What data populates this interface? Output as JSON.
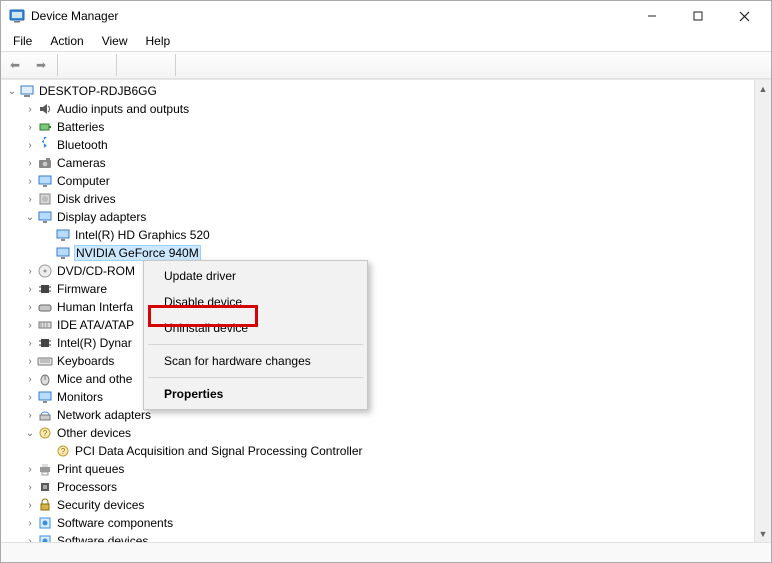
{
  "titlebar": {
    "title": "Device Manager"
  },
  "menubar": {
    "file": "File",
    "action": "Action",
    "view": "View",
    "help": "Help"
  },
  "root": {
    "name": "DESKTOP-RDJB6GG"
  },
  "categories": [
    {
      "label": "Audio inputs and outputs",
      "expanded": false,
      "icon": "speaker"
    },
    {
      "label": "Batteries",
      "expanded": false,
      "icon": "battery"
    },
    {
      "label": "Bluetooth",
      "expanded": false,
      "icon": "bluetooth"
    },
    {
      "label": "Cameras",
      "expanded": false,
      "icon": "camera"
    },
    {
      "label": "Computer",
      "expanded": false,
      "icon": "monitor"
    },
    {
      "label": "Disk drives",
      "expanded": false,
      "icon": "disk"
    },
    {
      "label": "Display adapters",
      "expanded": true,
      "icon": "monitor",
      "children": [
        {
          "label": "Intel(R) HD Graphics 520",
          "icon": "monitor"
        },
        {
          "label": "NVIDIA GeForce 940M",
          "icon": "monitor",
          "selected": true
        }
      ]
    },
    {
      "label": "DVD/CD-ROM",
      "expanded": false,
      "icon": "cd",
      "truncated": true
    },
    {
      "label": "Firmware",
      "expanded": false,
      "icon": "chip"
    },
    {
      "label": "Human Interfa",
      "expanded": false,
      "icon": "hid",
      "truncated": true
    },
    {
      "label": "IDE ATA/ATAP",
      "expanded": false,
      "icon": "ide",
      "truncated": true
    },
    {
      "label": "Intel(R) Dynar",
      "expanded": false,
      "icon": "chip",
      "truncated": true
    },
    {
      "label": "Keyboards",
      "expanded": false,
      "icon": "keyboard"
    },
    {
      "label": "Mice and othe",
      "expanded": false,
      "icon": "mouse",
      "truncated": true
    },
    {
      "label": "Monitors",
      "expanded": false,
      "icon": "monitor"
    },
    {
      "label": "Network adapters",
      "expanded": false,
      "icon": "net"
    },
    {
      "label": "Other devices",
      "expanded": true,
      "icon": "other",
      "children": [
        {
          "label": "PCI Data Acquisition and Signal Processing Controller",
          "icon": "warn"
        }
      ]
    },
    {
      "label": "Print queues",
      "expanded": false,
      "icon": "printer"
    },
    {
      "label": "Processors",
      "expanded": false,
      "icon": "cpu"
    },
    {
      "label": "Security devices",
      "expanded": false,
      "icon": "lock"
    },
    {
      "label": "Software components",
      "expanded": false,
      "icon": "sw"
    },
    {
      "label": "Software devices",
      "expanded": false,
      "icon": "sw"
    }
  ],
  "context_menu": {
    "update": "Update driver",
    "disable": "Disable device",
    "uninstall": "Uninstall device",
    "scan": "Scan for hardware changes",
    "properties": "Properties"
  }
}
